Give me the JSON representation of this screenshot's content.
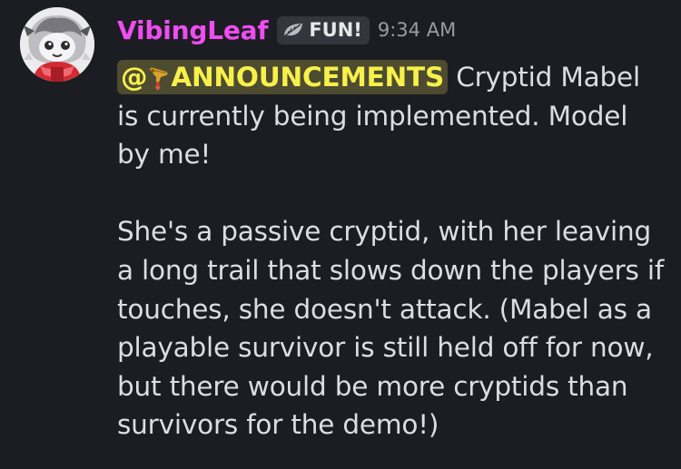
{
  "author": {
    "name": "VibingLeaf",
    "avatar_icon": "cartoon-character-avatar"
  },
  "role_tag": {
    "icon": "leaf-icon",
    "label": "FUN!"
  },
  "timestamp": "9:34 AM",
  "message": {
    "mention": {
      "prefix": "@",
      "icon": "horn-icon",
      "label": "ANNOUNCEMENTS"
    },
    "text_1": " Cryptid Mabel is currently being implemented. Model by me!",
    "text_2": "She's a passive cryptid, with her leaving a long trail that slows down the players if touches, she doesn't attack. (Mabel as a playable survivor is still held off for now, but there would be more cryptids than survivors for the demo!)"
  },
  "colors": {
    "background": "#1c1d22",
    "username": "#ee4df0",
    "mention_text": "#f7f04a",
    "mention_bg": "#4d4b30",
    "body_text": "#dbdde2",
    "timestamp": "#9a9ca3"
  }
}
